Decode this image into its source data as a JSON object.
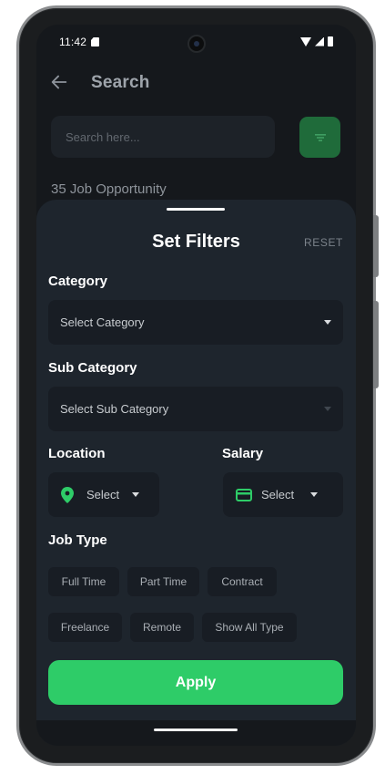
{
  "status_bar": {
    "time": "11:42"
  },
  "app_bar": {
    "title": "Search"
  },
  "search": {
    "placeholder": "Search here..."
  },
  "results": {
    "count_text": "35 Job Opportunity"
  },
  "filters": {
    "title": "Set Filters",
    "reset_label": "RESET",
    "category": {
      "label": "Category",
      "value": "Select Category"
    },
    "sub_category": {
      "label": "Sub Category",
      "value": "Select Sub Category"
    },
    "location": {
      "label": "Location",
      "value": "Select"
    },
    "salary": {
      "label": "Salary",
      "value": "Select"
    },
    "job_type": {
      "label": "Job Type",
      "chips": [
        "Full Time",
        "Part Time",
        "Contract",
        "Freelance",
        "Remote",
        "Show All Type"
      ]
    },
    "apply_label": "Apply"
  },
  "colors": {
    "accent": "#2ecc68",
    "sheet_background": "#1e252d",
    "field_background": "#181d24"
  },
  "icons": {
    "back": "arrow-left-icon",
    "filter": "filter-icon",
    "location": "location-pin-icon",
    "salary": "credit-card-icon"
  }
}
